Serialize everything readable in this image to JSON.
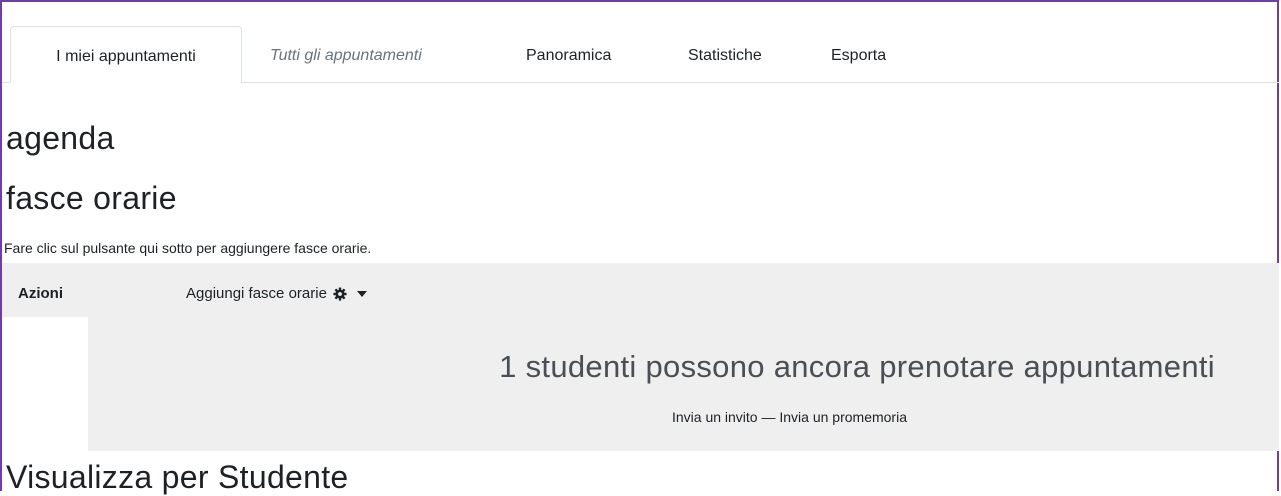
{
  "tabs": [
    {
      "label": "I miei appuntamenti"
    },
    {
      "label": "Tutti gli appuntamenti"
    },
    {
      "label": "Panoramica"
    },
    {
      "label": "Statistiche"
    },
    {
      "label": "Esporta"
    }
  ],
  "headings": {
    "agenda": "agenda",
    "slots": "fasce orarie",
    "by_student": "Visualizza per Studente"
  },
  "intro_text": "Fare clic sul pulsante qui sotto per aggiungere fasce orarie.",
  "actions": {
    "label": "Azioni",
    "menu_label": "Aggiungi fasce orarie"
  },
  "info": {
    "title": "1 studenti possono ancora prenotare appuntamenti",
    "invite_link": "Invia un invito",
    "separator": " — ",
    "reminder_link": "Invia un promemoria"
  },
  "icons": {
    "actions_menu": "gear-icon",
    "dropdown": "caret-down-icon"
  },
  "colors": {
    "frame_border": "#6f3fa0",
    "panel_bg": "#efefef"
  }
}
